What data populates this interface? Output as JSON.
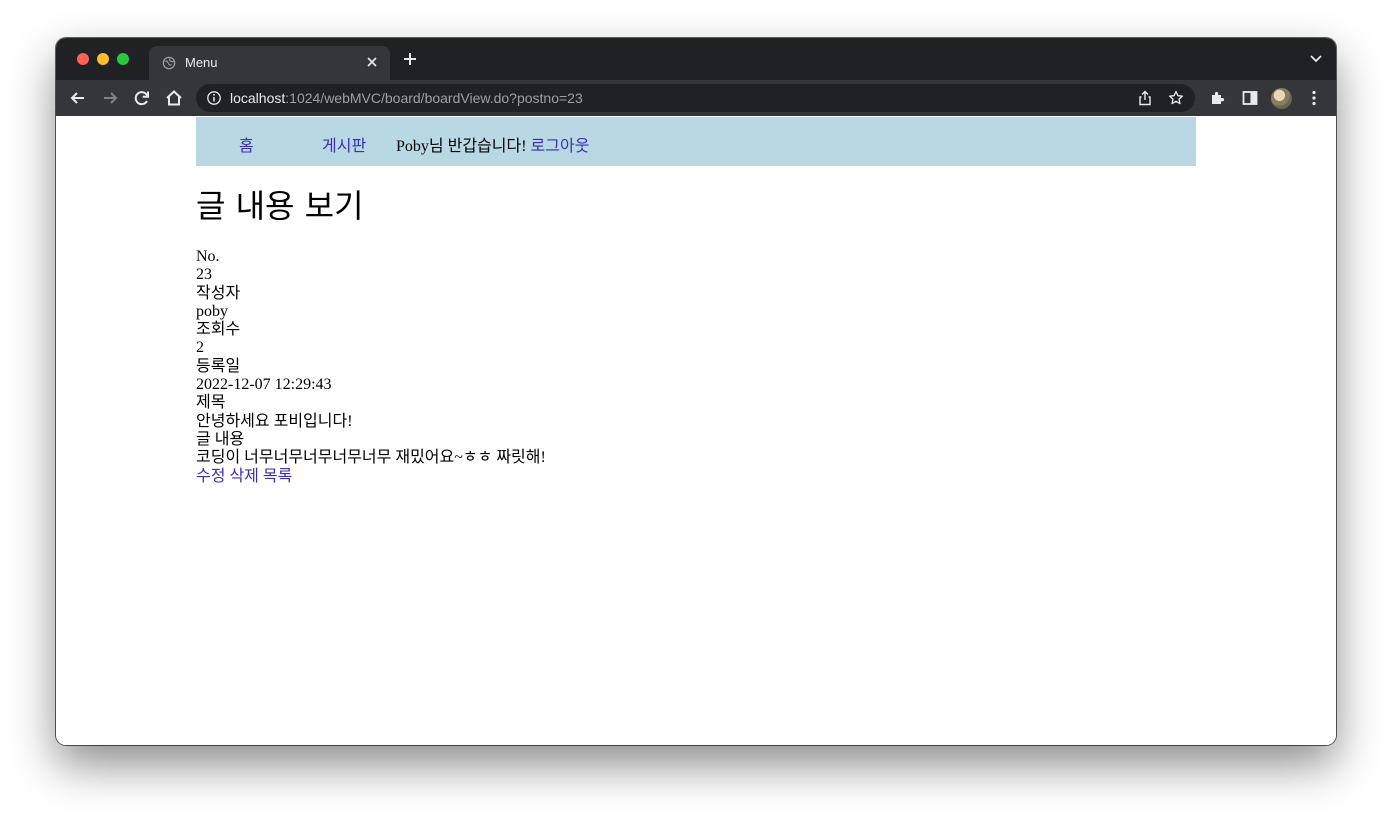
{
  "browser": {
    "tab_title": "Menu",
    "url_host": "localhost",
    "url_rest": ":1024/webMVC/board/boardView.do?postno=23"
  },
  "nav": {
    "home": "홈",
    "board": "게시판",
    "greeting": "Poby님 반갑습니다! ",
    "logout": "로그아웃"
  },
  "page": {
    "title": "글 내용 보기"
  },
  "post": {
    "no_label": "No.",
    "no_value": "23",
    "writer_label": "작성자",
    "writer_value": "poby",
    "views_label": "조회수",
    "views_value": "2",
    "date_label": "등록일",
    "date_value": "2022-12-07 12:29:43",
    "subject_label": "제목",
    "subject_value": "안녕하세요 포비입니다!",
    "body_label": "글 내용",
    "body_value": "코딩이 너무너무너무너무너무 재밌어요~ㅎㅎ 짜릿해!"
  },
  "actions": {
    "edit": "수정",
    "delete": "삭제",
    "list": "목록"
  },
  "colors": {
    "navbar_bg": "#b8d8e3",
    "link": "#3b2fb0"
  }
}
